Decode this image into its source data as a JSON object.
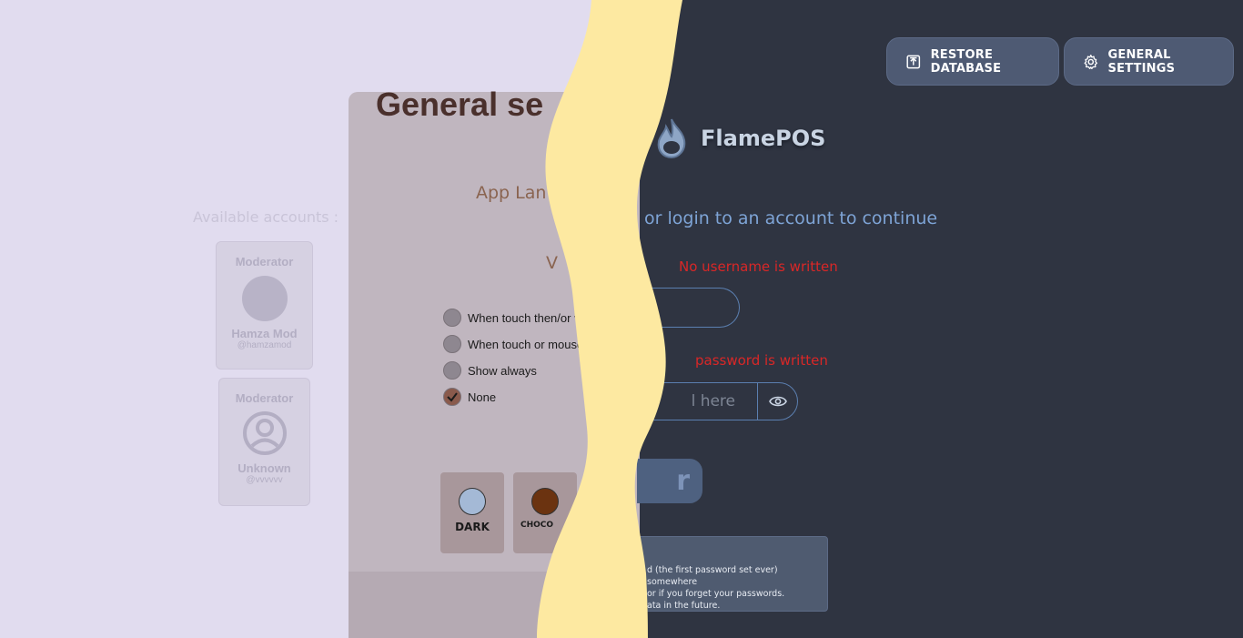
{
  "header": {
    "restore_label": "RESTORE DATABASE",
    "settings_label": "GENERAL SETTINGS"
  },
  "login": {
    "logo_text": "FlamePOS",
    "heading": "or login to an account to continue",
    "username_error": "No username is written",
    "password_error": "password is written",
    "password_placeholder": "l here",
    "submit_label": "r",
    "note_lines": [
      "d (the first password set ever) somewhere",
      "or if you forget your passwords.",
      "ata in the future."
    ]
  },
  "accounts": {
    "heading": "Available accounts :",
    "items": [
      {
        "role": "Moderator",
        "name": "Hamza Mod",
        "handle": "@hamzamod"
      },
      {
        "role": "Moderator",
        "name": "Unknown",
        "handle": "@vvvvvv"
      }
    ]
  },
  "settings_panel": {
    "title": "General se",
    "app_language_label": "App Lan",
    "visibility_label": "V",
    "radio_options": [
      {
        "label": "When touch then/or v",
        "checked": false
      },
      {
        "label": "When touch or mouse",
        "checked": false
      },
      {
        "label": "Show always",
        "checked": false
      },
      {
        "label": "None",
        "checked": true
      }
    ],
    "themes": [
      {
        "label": "DARK",
        "color": "#a4b9d6"
      },
      {
        "label": "CHOCO",
        "color": "#6b3310"
      }
    ]
  },
  "colors": {
    "wave": "#fde9a1",
    "error": "#d92727",
    "accent": "#7ea4d6"
  }
}
